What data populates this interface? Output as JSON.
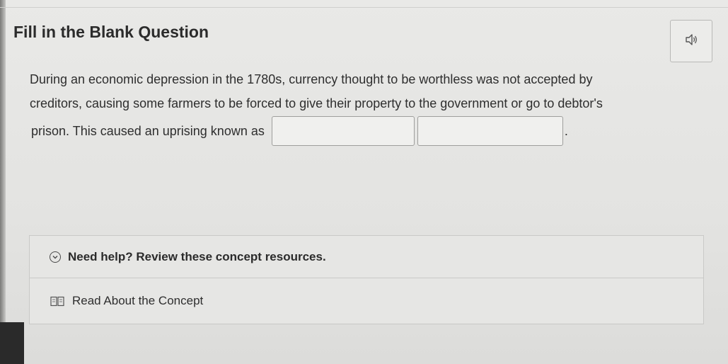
{
  "question": {
    "title": "Fill in the Blank Question",
    "line1": "During an economic depression in the 1780s, currency thought to be worthless was not accepted by",
    "line2": "creditors, causing some farmers to be forced to give their property to the government or go to debtor's",
    "line3": "prison. This caused an uprising known as",
    "period": ".",
    "blank1_value": "",
    "blank2_value": ""
  },
  "audio": {
    "icon": "speaker-icon"
  },
  "help": {
    "header": "Need help? Review these concept resources.",
    "chevron_icon": "chevron-down-icon",
    "resources": [
      {
        "label": "Read About the Concept",
        "icon": "book-icon"
      }
    ]
  },
  "colors": {
    "background": "#e6e6e4",
    "text": "#2e2e2e",
    "border": "#c9c9c7"
  }
}
